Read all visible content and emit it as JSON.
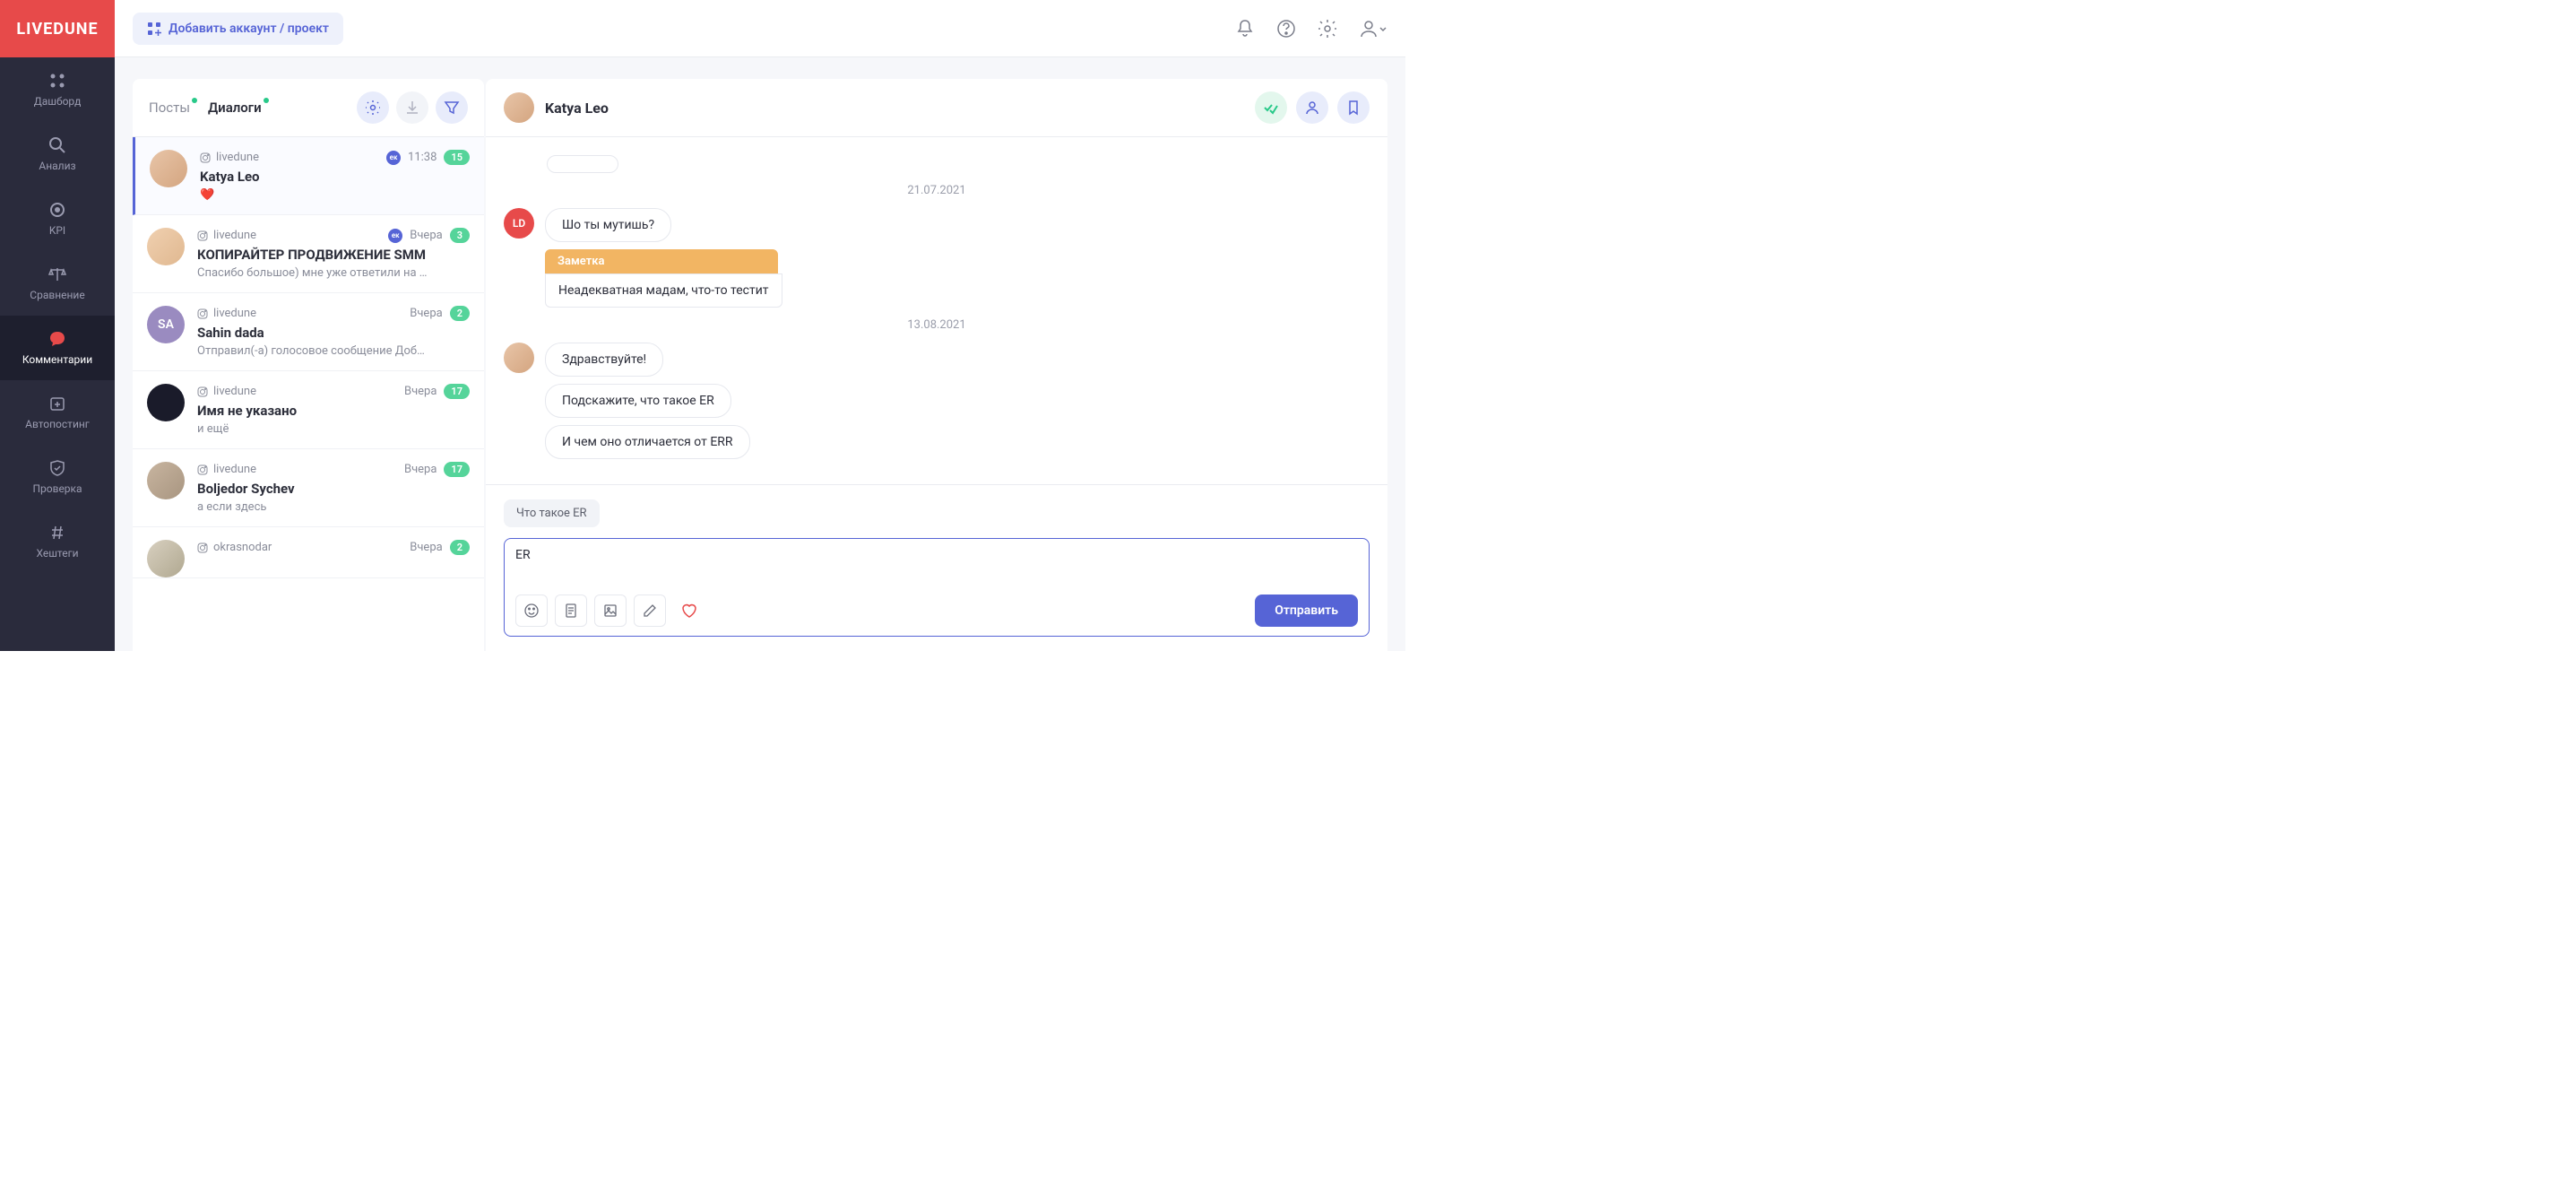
{
  "brand": "LIVEDUNE",
  "topbar": {
    "add_button": "Добавить аккаунт / проект"
  },
  "sidebar": {
    "items": [
      {
        "label": "Дашборд"
      },
      {
        "label": "Анализ"
      },
      {
        "label": "KPI"
      },
      {
        "label": "Сравнение"
      },
      {
        "label": "Комментарии"
      },
      {
        "label": "Автопостинг"
      },
      {
        "label": "Проверка"
      },
      {
        "label": "Хештеги"
      }
    ]
  },
  "tabs": {
    "posts": "Посты",
    "dialogs": "Диалоги"
  },
  "dialogs": [
    {
      "account": "livedune",
      "time": "11:38",
      "count": "15",
      "name": "Katya Leo",
      "preview": "❤️",
      "ek": true
    },
    {
      "account": "livedune",
      "time": "Вчера",
      "count": "3",
      "name": "КОПИРАЙТЕР ПРОДВИЖЕНИЕ SMM",
      "preview": "Спасибо большое) мне уже ответили на …",
      "ek": true
    },
    {
      "account": "livedune",
      "time": "Вчера",
      "count": "2",
      "name": "Sahin dada",
      "preview": "Отправил(-а) голосовое сообщение Доб…",
      "initials": "SA"
    },
    {
      "account": "livedune",
      "time": "Вчера",
      "count": "17",
      "name": "Имя не указано",
      "preview": "и ещё"
    },
    {
      "account": "livedune",
      "time": "Вчера",
      "count": "17",
      "name": "Boljedor Sychev",
      "preview": "а если здесь"
    },
    {
      "account": "okrasnodar",
      "time": "Вчера",
      "count": "2",
      "name": "",
      "preview": ""
    }
  ],
  "chat": {
    "name": "Katya Leo",
    "date1": "21.07.2021",
    "date2": "13.08.2021",
    "msg1": "Шо ты мутишь?",
    "note_label": "Заметка",
    "note_body": "Неадекватная мадам, что-то тестит",
    "msg2": "Здравствуйте!",
    "msg3": "Подскажите, что такое ER",
    "msg4": "И чем оно отличается от ERR",
    "suggestion": "Что такое ER",
    "input_value": "ER",
    "send": "Отправить"
  }
}
